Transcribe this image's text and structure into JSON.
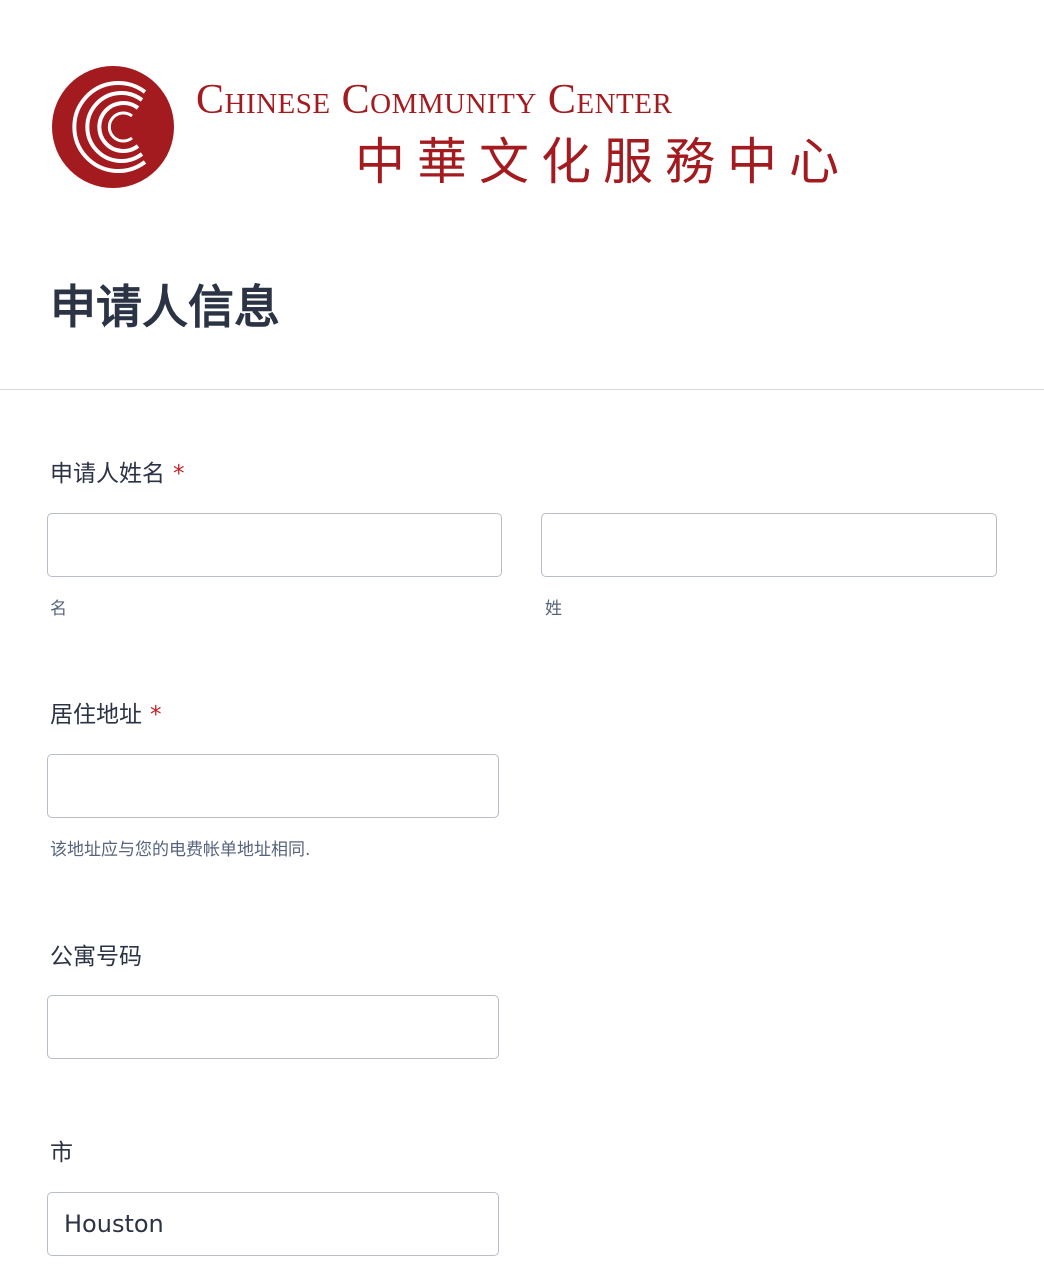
{
  "header": {
    "logo_en": "Chinese Community Center",
    "logo_zh": "中華文化服務中心"
  },
  "section": {
    "title": "申请人信息"
  },
  "fields": {
    "name": {
      "label": "申请人姓名",
      "required_mark": "*",
      "first_value": "",
      "first_sublabel": "名",
      "last_value": "",
      "last_sublabel": "姓"
    },
    "address": {
      "label": "居住地址",
      "required_mark": "*",
      "value": "",
      "help": "该地址应与您的电费帐单地址相同."
    },
    "apartment": {
      "label": "公寓号码",
      "value": ""
    },
    "city": {
      "label": "市",
      "value": "Houston"
    }
  },
  "colors": {
    "brand": "#a31a1f",
    "required": "#c0222c",
    "text": "#2c3345",
    "border": "#b8bdc9"
  }
}
